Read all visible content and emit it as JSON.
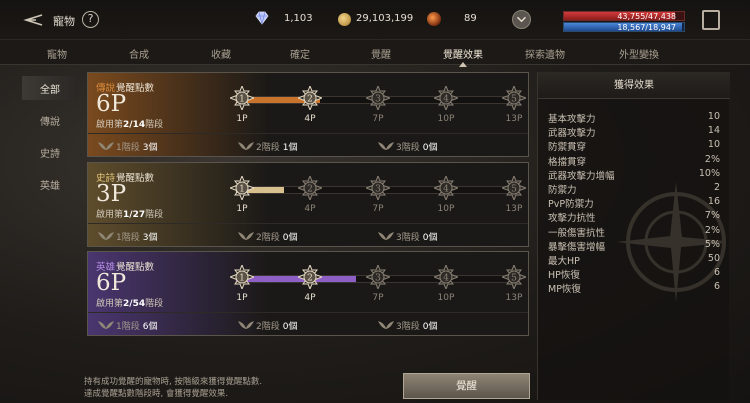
{
  "header": {
    "title": "寵物",
    "help_label": "?",
    "diamonds": "1,103",
    "gold": "29,103,199",
    "orbs": "89",
    "hp_text": "43,755/47,438",
    "mp_text": "18,567/18,947",
    "hp_ratio": 0.922,
    "mp_ratio": 0.98
  },
  "tabs": [
    "寵物",
    "合成",
    "收藏",
    "確定",
    "覺醒",
    "覺醒效果",
    "探索遺物",
    "外型變換"
  ],
  "active_tab": "覺醒效果",
  "side": {
    "items": [
      "全部",
      "傳說",
      "史詩",
      "英雄"
    ],
    "active": "全部"
  },
  "cards": [
    {
      "grade": "傳說",
      "title_suffix": "覺醒點數",
      "points": "6P",
      "stage_prefix": "啟用第",
      "stage_value": "2/14",
      "stage_suffix": "階段",
      "fill_ratio": 0.3,
      "grade_color": "#d98a3a",
      "tint": "#7a4a1e",
      "fill_color": "#c8742c",
      "nodes": [
        "1",
        "2",
        "3",
        "4",
        "5"
      ],
      "node_labels": [
        "1P",
        "4P",
        "7P",
        "10P",
        "13P"
      ],
      "lit_nodes": 2,
      "footer": [
        {
          "label": "1階段",
          "count": "3個"
        },
        {
          "label": "2階段",
          "count": "1個"
        },
        {
          "label": "3階段",
          "count": "0個"
        }
      ]
    },
    {
      "grade": "史詩",
      "title_suffix": "覺醒點數",
      "points": "3P",
      "stage_prefix": "啟用第",
      "stage_value": "1/27",
      "stage_suffix": "階段",
      "fill_ratio": 0.17,
      "grade_color": "#e7c97a",
      "tint": "#5e4d2c",
      "fill_color": "#d8c08e",
      "nodes": [
        "1",
        "2",
        "3",
        "4",
        "5"
      ],
      "node_labels": [
        "1P",
        "4P",
        "7P",
        "10P",
        "13P"
      ],
      "lit_nodes": 1,
      "footer": [
        {
          "label": "1階段",
          "count": "3個"
        },
        {
          "label": "2階段",
          "count": "0個"
        },
        {
          "label": "3階段",
          "count": "0個"
        }
      ]
    },
    {
      "grade": "英雄",
      "title_suffix": "覺醒點數",
      "points": "6P",
      "stage_prefix": "啟用第",
      "stage_value": "2/54",
      "stage_suffix": "階段",
      "fill_ratio": 0.43,
      "grade_color": "#b58ce6",
      "tint": "#4a3670",
      "fill_color": "#8e5fc4",
      "nodes": [
        "1",
        "2",
        "3",
        "4",
        "5"
      ],
      "node_labels": [
        "1P",
        "4P",
        "7P",
        "10P",
        "13P"
      ],
      "lit_nodes": 2,
      "footer": [
        {
          "label": "1階段",
          "count": "6個"
        },
        {
          "label": "2階段",
          "count": "0個"
        },
        {
          "label": "3階段",
          "count": "0個"
        }
      ]
    }
  ],
  "effects": {
    "title": "獲得效果",
    "stats": [
      {
        "name": "基本攻擊力",
        "value": "10"
      },
      {
        "name": "武器攻擊力",
        "value": "14"
      },
      {
        "name": "防禦貫穿",
        "value": "10"
      },
      {
        "name": "格擋貫穿",
        "value": "2%"
      },
      {
        "name": "武器攻擊力增幅",
        "value": "10%"
      },
      {
        "name": "防禦力",
        "value": "2"
      },
      {
        "name": "PvP防禦力",
        "value": "16"
      },
      {
        "name": "攻擊力抗性",
        "value": "7%"
      },
      {
        "name": "一般傷害抗性",
        "value": "2%"
      },
      {
        "name": "暴擊傷害增幅",
        "value": "5%"
      },
      {
        "name": "最大HP",
        "value": "50"
      },
      {
        "name": "HP恢復",
        "value": "6"
      },
      {
        "name": "MP恢復",
        "value": "6"
      }
    ]
  },
  "notes": [
    "持有成功覺醒的寵物時, 按階級來獲得覺醒點數.",
    "達成覺醒點數階段時, 會獲得覺醒效果."
  ],
  "awaken_button": "覺醒"
}
